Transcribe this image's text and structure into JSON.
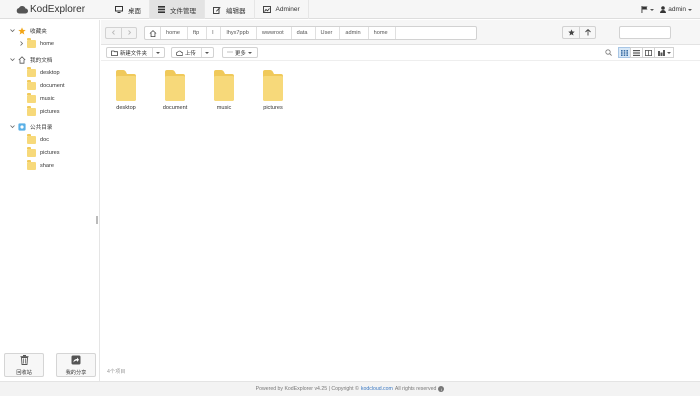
{
  "app": {
    "logo_text": "KodExplorer"
  },
  "nav": {
    "items": [
      {
        "label": "桌面",
        "icon": "monitor-icon",
        "active": false
      },
      {
        "label": "文件管理",
        "icon": "file-manager-icon",
        "active": true
      },
      {
        "label": "编辑器",
        "icon": "editor-icon",
        "active": false
      },
      {
        "label": "Adminer",
        "icon": "adminer-icon",
        "active": false
      }
    ]
  },
  "topright": {
    "flag_icon": "flag-icon",
    "user_label": "admin",
    "user_icon": "user-icon"
  },
  "sidebar": {
    "favorites_label": "收藏夹",
    "favorites_items": [
      "home"
    ],
    "mydocs_label": "我的文档",
    "mydocs_items": [
      "desktop",
      "document",
      "music",
      "pictures"
    ],
    "public_label": "公共目录",
    "public_items": [
      "doc",
      "pictures",
      "share"
    ],
    "recycle_label": "回收站",
    "share_label": "我的分享"
  },
  "addressbar": {
    "crumbs": [
      "home",
      "ftp",
      "l",
      "lhyx7ppb",
      "wwwroot",
      "data",
      "User",
      "admin",
      "home"
    ],
    "back_icon": "arrow-left-icon",
    "forward_icon": "arrow-right-icon",
    "star_icon": "star-icon",
    "up_icon": "arrow-up-icon",
    "search_value": ""
  },
  "toolbar": {
    "new_folder_label": "新建文件夹",
    "upload_label": "上传",
    "more_label": "更多"
  },
  "files": [
    {
      "name": "desktop"
    },
    {
      "name": "document"
    },
    {
      "name": "music"
    },
    {
      "name": "pictures"
    }
  ],
  "status": {
    "item_count": "4个项目"
  },
  "footer": {
    "prefix": "Powered by KodExplorer v4.25 | Copyright ©",
    "link": "kodcloud.com",
    "suffix": "All rights reserved"
  },
  "colors": {
    "folder": "#f7d97a",
    "folder_dark": "#f0c95a",
    "accent": "#3a78c3",
    "active_view": "#d8e8f7"
  }
}
